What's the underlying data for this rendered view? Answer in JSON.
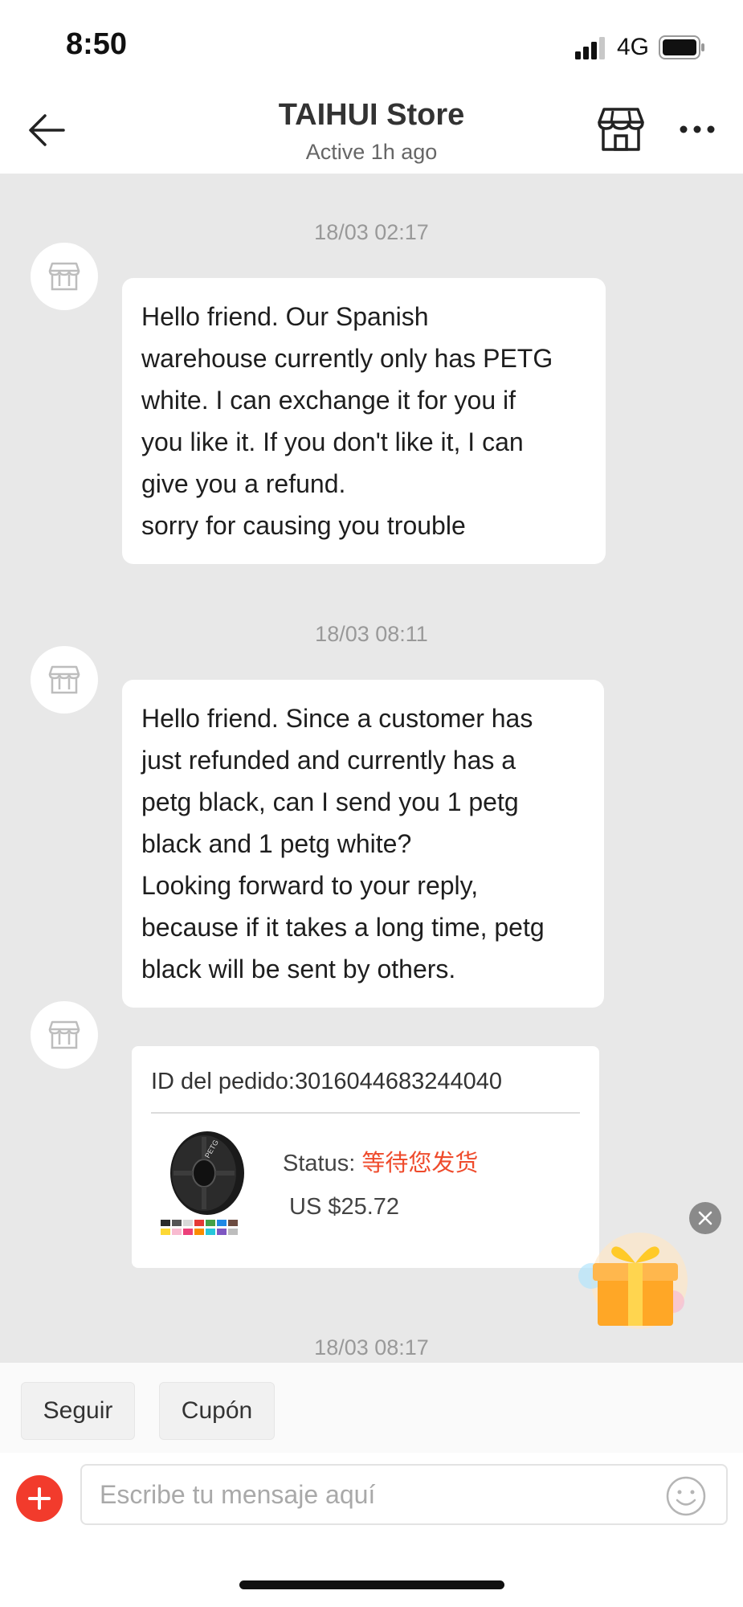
{
  "status_bar": {
    "time": "8:50",
    "network": "4G"
  },
  "header": {
    "store_name": "TAIHUI Store",
    "status": "Active 1h ago"
  },
  "messages": [
    {
      "timestamp": "18/03 02:17",
      "lines": [
        "Hello friend. Our Spanish",
        "warehouse currently only has PETG",
        "white. I can exchange it for you if",
        "you like it. If you don't like it, I can",
        "give you a refund.",
        "sorry for causing you trouble"
      ]
    },
    {
      "timestamp": "18/03 08:11",
      "lines": [
        "Hello friend. Since a customer has",
        "just refunded and currently has a",
        "petg black, can I send you 1 petg",
        "black and 1 petg white?",
        "Looking forward to your reply,",
        "because if it takes a long time, petg",
        "black will be sent by others."
      ]
    }
  ],
  "order_card": {
    "order_id": "ID del pedido:3016044683244040",
    "status_label": "Status: ",
    "status_value": "等待您发货",
    "price": "US $25.72",
    "product_label": "PETG"
  },
  "next_timestamp": "18/03 08:17",
  "quick_actions": {
    "follow": "Seguir",
    "coupon": "Cupón"
  },
  "input": {
    "placeholder": "Escribe tu mensaje aquí"
  },
  "colors": {
    "accent": "#f23b2c",
    "status": "#ef4b2c",
    "chat_bg": "#e8e8e8"
  }
}
